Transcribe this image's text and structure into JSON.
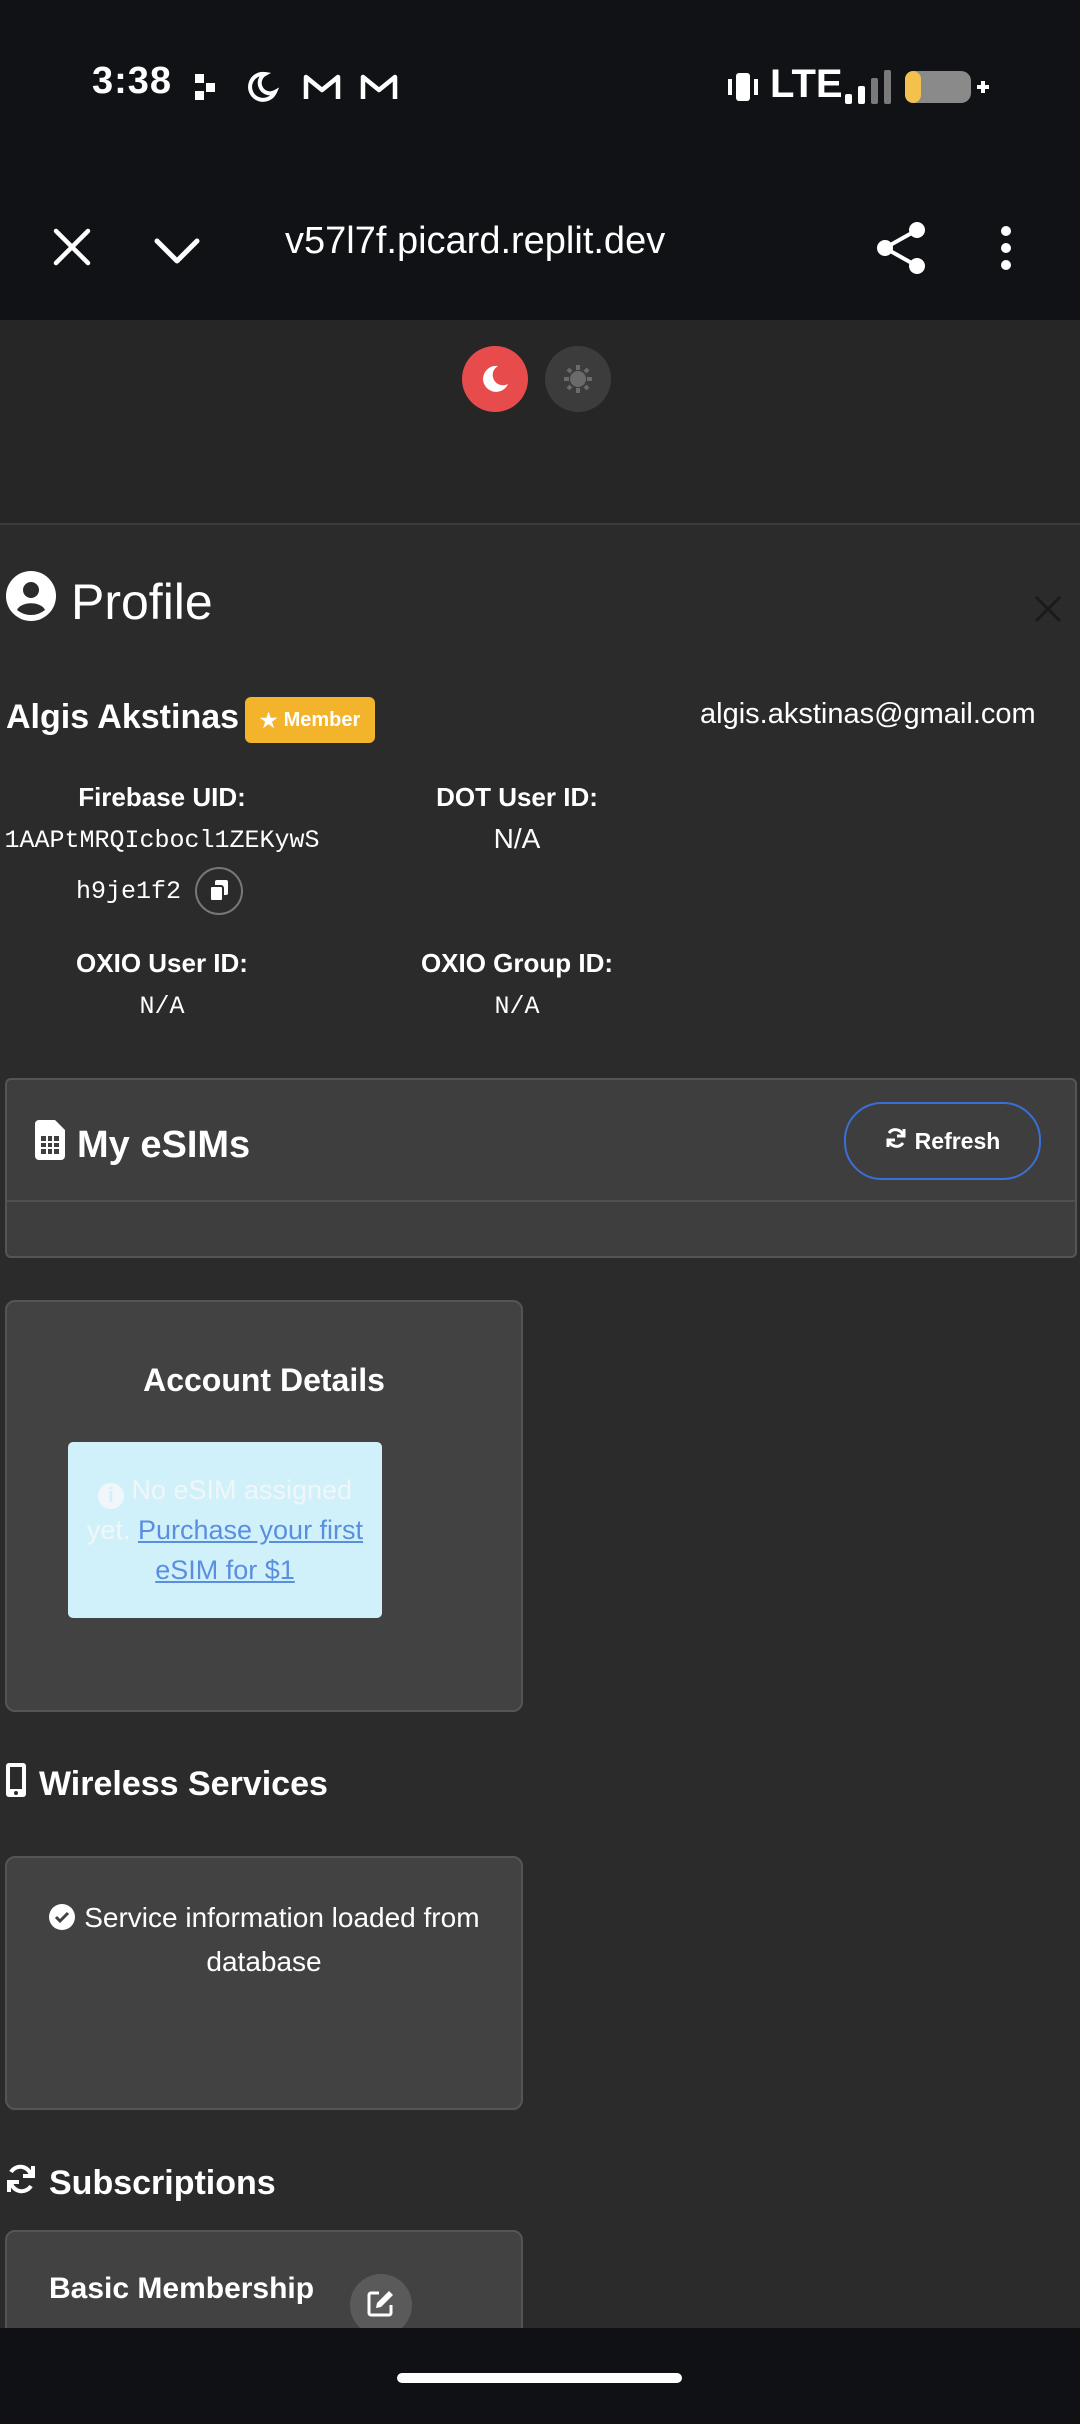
{
  "status_bar": {
    "time": "3:38",
    "network": "LTE",
    "icons": [
      "notification-dots-icon",
      "do-not-disturb-moon-icon",
      "gmail-icon",
      "gmail-icon",
      "vibrate-icon",
      "signal-icon",
      "battery-icon"
    ]
  },
  "browser": {
    "url": "v57l7f.picard.replit.dev",
    "icons": [
      "close-icon",
      "chevron-down-icon",
      "share-icon",
      "more-vert-icon"
    ]
  },
  "theme": {
    "active": "dark",
    "accent": "#e84b4b"
  },
  "profile": {
    "title": "Profile",
    "name": "Algis Akstinas",
    "badge": "Member",
    "badge_color": "#f3b32a",
    "email": "algis.akstinas@gmail.com",
    "firebase_uid_label": "Firebase UID:",
    "firebase_uid_line1": "1AAPtMRQIcbocl1ZEKywS",
    "firebase_uid_line2": "h9je1f2",
    "dot_user_id_label": "DOT User ID:",
    "dot_user_id": "N/A",
    "oxio_user_id_label": "OXIO User ID:",
    "oxio_user_id": "N/A",
    "oxio_group_id_label": "OXIO Group ID:",
    "oxio_group_id": "N/A"
  },
  "esims": {
    "title": "My eSIMs",
    "refresh_label": "Refresh"
  },
  "account": {
    "title": "Account Details",
    "notice_text": "No eSIM assigned yet.",
    "notice_link": "Purchase your first eSIM for $1"
  },
  "wireless": {
    "title": "Wireless Services",
    "message": "Service information loaded from database"
  },
  "subscriptions": {
    "title": "Subscriptions",
    "plan_name": "Basic Membership"
  }
}
